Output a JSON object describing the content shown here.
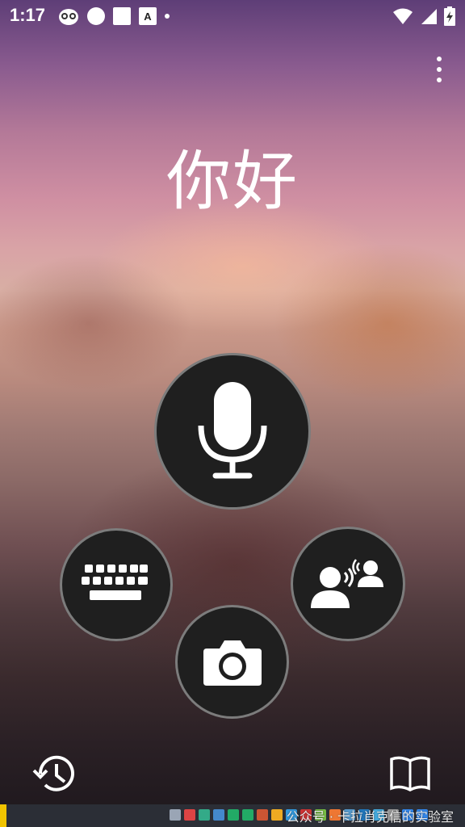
{
  "status_bar": {
    "time": "1:17",
    "left_icons": [
      "owl-icon",
      "circle-icon",
      "square-icon",
      "translate-a-icon",
      "dot-icon"
    ],
    "right_icons": [
      "wifi-icon",
      "signal-icon",
      "battery-charging-icon"
    ]
  },
  "app": {
    "greeting": "你好",
    "menu_icon": "more-vert-icon"
  },
  "actions": {
    "microphone": "microphone-icon",
    "keyboard": "keyboard-icon",
    "camera": "camera-icon",
    "conversation": "conversation-icon",
    "history": "history-icon",
    "phrasebook": "phrasebook-icon"
  },
  "overlay": {
    "watermark": "公众号 · 卡拉肖克信的实验室"
  },
  "colors": {
    "button_bg": "#1f1f1f",
    "icon": "#ffffff",
    "taskbar": "#2b2e36"
  }
}
